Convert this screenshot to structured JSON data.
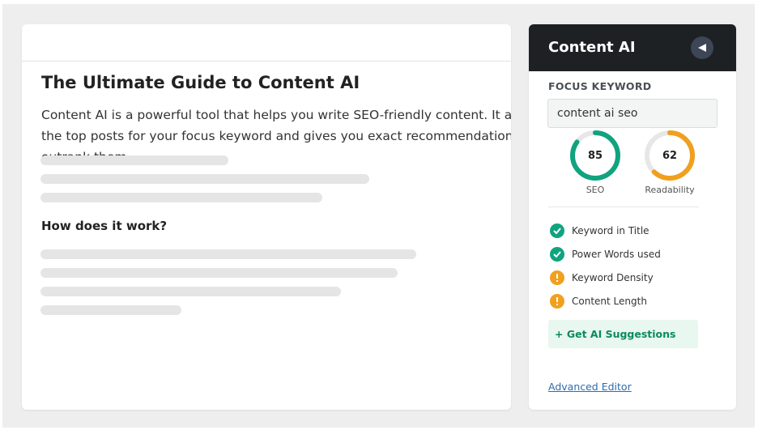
{
  "post": {
    "title": "The Ultimate Guide to Content AI",
    "intro": "Content AI is a powerful tool that helps you write SEO-friendly content. It analyzes the top posts for your focus keyword and gives you exact recommendations to outrank them.",
    "subheading": "How does it work?"
  },
  "panel": {
    "title": "Content AI",
    "collapse_icon": "collapse-arrow-icon",
    "focus_keyword_label": "FOCUS KEYWORD",
    "focus_keyword_value": "content ai seo",
    "scores": [
      {
        "label": "SEO",
        "value": "85",
        "percent": 85,
        "color": "#10a37f"
      },
      {
        "label": "Readability",
        "value": "62",
        "percent": 62,
        "color": "#f0a01e"
      }
    ],
    "checks": [
      {
        "label": "Keyword in Title",
        "status": "pass",
        "icon": "check-icon",
        "color": "#10a37f"
      },
      {
        "label": "Power Words used",
        "status": "pass",
        "icon": "check-icon",
        "color": "#10a37f"
      },
      {
        "label": "Keyword Density",
        "status": "warning",
        "icon": "warning-icon",
        "color": "#f0a01e"
      },
      {
        "label": "Content Length",
        "status": "warning",
        "icon": "warning-icon",
        "color": "#f0a01e"
      }
    ],
    "ai_button_label": "+ Get AI Suggestions",
    "advanced_editor_label": "Advanced Editor"
  },
  "colors": {
    "accent_green": "#10a37f",
    "accent_orange": "#f0a01e",
    "header_dark": "#1e2124",
    "link": "#2c6cb0"
  }
}
